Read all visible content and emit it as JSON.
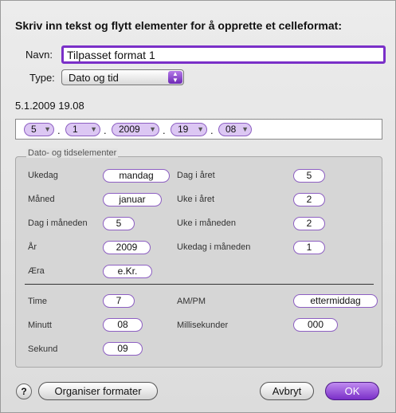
{
  "dialog": {
    "instruction": "Skriv inn tekst og flytt elementer for å opprette et celleformat:",
    "name_label": "Navn:",
    "name_value": "Tilpasset format 1",
    "type_label": "Type:",
    "type_value": "Dato og tid",
    "preview": "5.1.2009 19.08"
  },
  "token_field": {
    "tokens": [
      "5",
      "1",
      "2009",
      "19",
      "08"
    ],
    "separators": [
      ".",
      ".",
      ".",
      "."
    ]
  },
  "elements": {
    "title": "Dato- og tidselementer",
    "ukedag_label": "Ukedag",
    "ukedag_value": "mandag",
    "dag_i_aret_label": "Dag i året",
    "dag_i_aret_value": "5",
    "maned_label": "Måned",
    "maned_value": "januar",
    "uke_i_aret_label": "Uke i året",
    "uke_i_aret_value": "2",
    "dag_i_maneden_label": "Dag i måneden",
    "dag_i_maneden_value": "5",
    "uke_i_maneden_label": "Uke i måneden",
    "uke_i_maneden_value": "2",
    "ar_label": "År",
    "ar_value": "2009",
    "ukedag_i_maneden_label": "Ukedag i måneden",
    "ukedag_i_maneden_value": "1",
    "era_label": "Æra",
    "era_value": "e.Kr.",
    "time_label": "Time",
    "time_value": "7",
    "ampm_label": "AM/PM",
    "ampm_value": "ettermiddag",
    "minutt_label": "Minutt",
    "minutt_value": "08",
    "millisekunder_label": "Millisekunder",
    "millisekunder_value": "000",
    "sekund_label": "Sekund",
    "sekund_value": "09"
  },
  "buttons": {
    "help": "?",
    "organize": "Organiser formater",
    "cancel": "Avbryt",
    "ok": "OK"
  }
}
